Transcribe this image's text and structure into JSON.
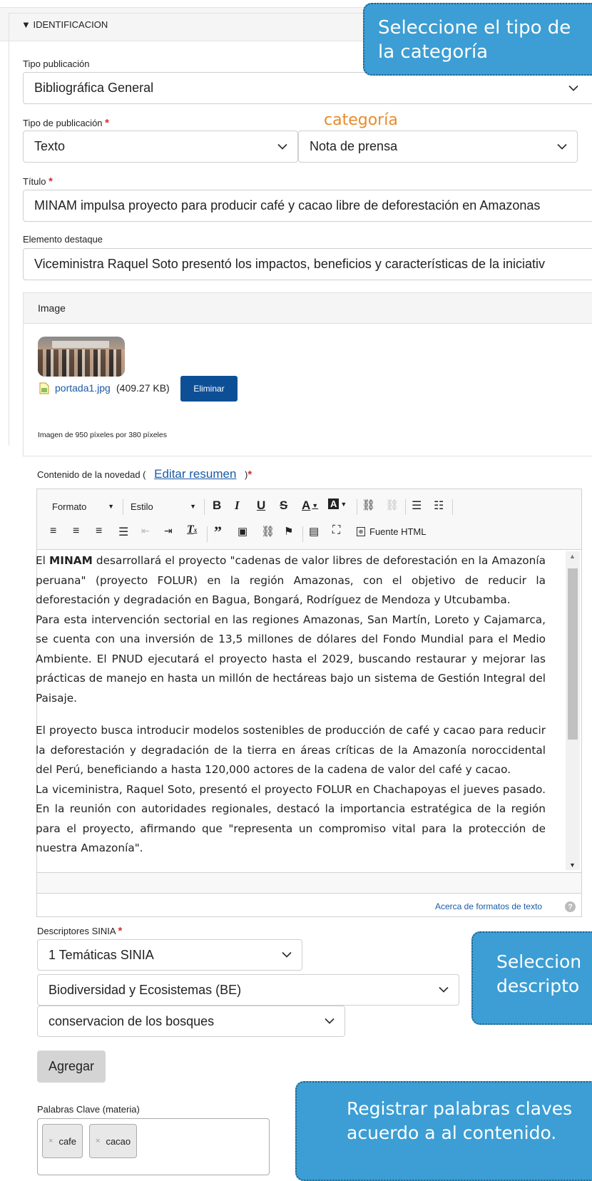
{
  "section": {
    "toggle_label": "▼ IDENTIFICACION"
  },
  "callouts": {
    "category": "Seleccione el tipo de la categoría",
    "category_line1": "Seleccione el tipo de",
    "category_line2": "la categoría",
    "descriptors_line1": "Seleccion",
    "descriptors_line2": "descripto",
    "keywords_line1": "Registrar palabras claves",
    "keywords_line2": "acuerdo a al contenido."
  },
  "fields": {
    "tipo_publicacion_label": "Tipo publicación",
    "tipo_publicacion_value": "Bibliográfica General",
    "tipo_de_publicacion_label": "Tipo de publicación",
    "tipo_de_publicacion_value": "Texto",
    "categoria_hint": "categoría",
    "categoria_value": "Nota de prensa",
    "titulo_label": "Título",
    "titulo_value": "MINAM impulsa proyecto para producir café y cacao libre de deforestación en Amazonas",
    "destaque_label": "Elemento destaque",
    "destaque_value": "Viceministra Raquel Soto presentó los impactos, beneficios y características de la iniciativ",
    "required_mark": "*"
  },
  "image": {
    "header": "Image",
    "file_name": "portada1.jpg",
    "file_size": "(409.27 KB)",
    "delete_label": "Eliminar",
    "hint": "Imagen de 950 píxeles por 380 píxeles"
  },
  "content": {
    "label_prefix": "Contenido de la novedad (",
    "edit_summary_link": "Editar resumen",
    "label_suffix": ")",
    "toolbar": {
      "format": "Formato",
      "style": "Estilo",
      "source": "Fuente HTML"
    },
    "paragraph1_bold": "MINAM",
    "paragraph1_pre": "El ",
    "paragraph1_post": " desarrollará el proyecto \"cadenas de valor libres de deforestación en la Amazonía peruana\" (proyecto FOLUR) en la región Amazonas, con el objetivo de reducir la deforestación y degradación en Bagua, Bongará, Rodríguez de Mendoza y Utcubamba.",
    "paragraph2": "Para esta intervención sectorial en las regiones Amazonas, San Martín, Loreto y Cajamarca, se cuenta con una inversión de 13,5 millones de dólares del Fondo Mundial para el Medio Ambiente. El PNUD ejecutará el proyecto hasta el 2029, buscando restaurar y mejorar las prácticas de manejo en hasta un millón de hectáreas bajo un sistema de Gestión Integral del Paisaje.",
    "paragraph3": "El proyecto busca introducir modelos sostenibles de producción de café y cacao para reducir la deforestación y degradación de la tierra en áreas críticas de la Amazonía noroccidental del Perú, beneficiando a hasta 120,000 actores de la cadena de valor del café y cacao.",
    "paragraph4": "La viceministra, Raquel Soto, presentó el proyecto FOLUR en Chachapoyas el jueves pasado. En la reunión con autoridades regionales, destacó la importancia estratégica de la región para el proyecto, afirmando que \"representa un compromiso vital para la protección de nuestra Amazonía\".",
    "formats_link": "Acerca de formatos de texto"
  },
  "descriptors": {
    "label": "Descriptores SINIA",
    "level1": "1 Temáticas SINIA",
    "level2": "Biodiversidad y Ecosistemas (BE)",
    "level3": "conservacion de los bosques",
    "add_label": "Agregar"
  },
  "keywords": {
    "label": "Palabras Clave (materia)",
    "tags": [
      "cafe",
      "cacao"
    ]
  },
  "colors": {
    "callout": "#3c9ed4",
    "accent_orange": "#e98b2a",
    "button_blue": "#0d4f96",
    "link_blue": "#1a5aa6"
  }
}
